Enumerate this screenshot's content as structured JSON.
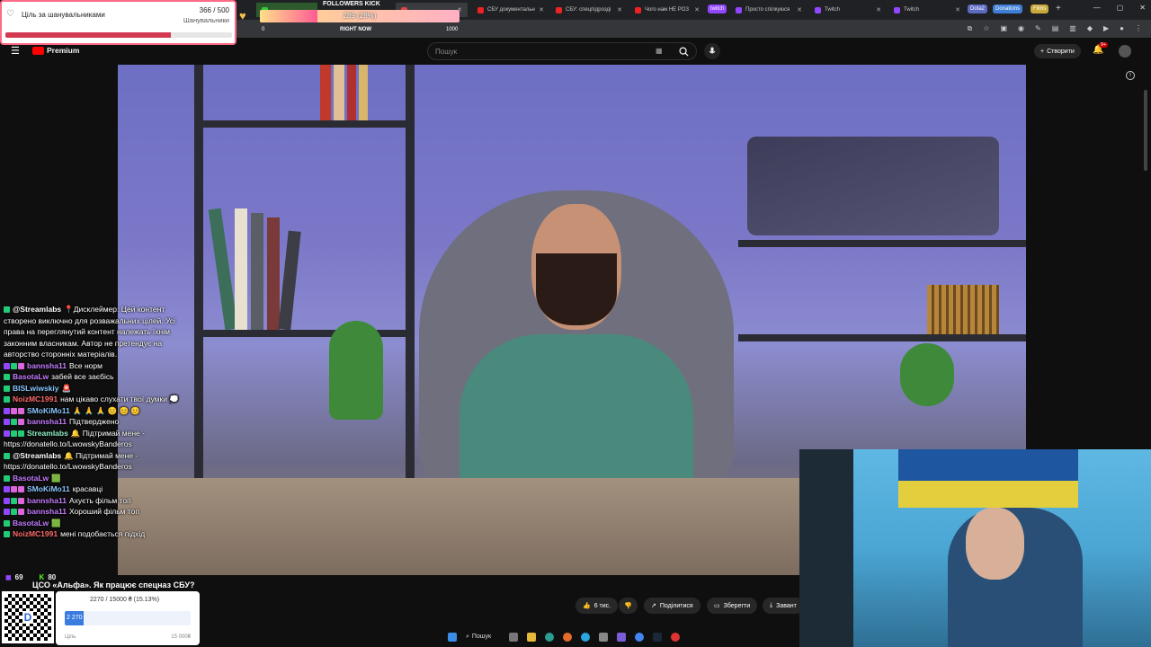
{
  "browser": {
    "tabs": [
      {
        "label": "",
        "color": "#2d8a2d"
      },
      {
        "label": "",
        "color": "#d44"
      },
      {
        "label": "СБУ документальн",
        "color": "#e22"
      },
      {
        "label": "СБУ: спецпідрозді",
        "color": "#e22"
      },
      {
        "label": "Чого нам НЕ РОЗ",
        "color": "#e22"
      },
      {
        "label": "",
        "color": "#9146ff"
      },
      {
        "label": "Просто спілкуюся",
        "color": "#9146ff"
      },
      {
        "label": "Twitch",
        "color": "#9146ff"
      },
      {
        "label": "Twitch",
        "color": "#9146ff"
      }
    ],
    "pills": {
      "twitch": "twitch",
      "dota": "Dota2",
      "donations": "Donations",
      "films": "Films"
    }
  },
  "youtube": {
    "logo": "Premium",
    "search_placeholder": "Пошук",
    "create_label": "Створити",
    "notif_count": "9+"
  },
  "goal": {
    "title": "Ціль за шанувальниками",
    "count": "366 / 500",
    "subtitle": "Шанувальники",
    "progress": 0.732
  },
  "kick": {
    "title": "FOLLOWERS KICK",
    "value_text": "289 (28%)",
    "progress": 0.289,
    "min": "0",
    "max": "1000",
    "caption": "RIGHT NOW"
  },
  "chat": [
    {
      "user": "@Streamlabs",
      "color": "#ffffff",
      "badges": [
        "#2c7"
      ],
      "text": "📍Дисклеймер: Цей контент створено виключно для розважальних цілей. Усі права на переглянутий контент належать їхнім законним власникам. Автор не претендує на авторство сторонніх матеріалів."
    },
    {
      "user": "bannsha11",
      "color": "#c57cff",
      "badges": [
        "#9146ff",
        "#2c7",
        "#d6d"
      ],
      "text": "Все норм"
    },
    {
      "user": "BasotaLw",
      "color": "#c57cff",
      "badges": [
        "#2c7"
      ],
      "text": "забей все заєбісь"
    },
    {
      "user": "BISLwiwskiy",
      "color": "#8ac6ff",
      "badges": [
        "#2c7"
      ],
      "text": "🚨"
    },
    {
      "user": "NoizMC1991",
      "color": "#ff6b6b",
      "badges": [
        "#2c7"
      ],
      "text": "нам цікаво слухати твої думки 💭"
    },
    {
      "user": "SMoKiMo11",
      "color": "#8ac6ff",
      "badges": [
        "#9146ff",
        "#d6d",
        "#d6d"
      ],
      "text": "🙏 🙏 🙏 😊 😊 😊"
    },
    {
      "user": "bannsha11",
      "color": "#c57cff",
      "badges": [
        "#9146ff",
        "#2c7",
        "#d6d"
      ],
      "text": "Підтверджено"
    },
    {
      "user": "Streamlabs",
      "color": "#8ef0c7",
      "badges": [
        "#9146ff",
        "#2c7",
        "#2c7"
      ],
      "text": "🔔 Підтримай мене - https://donatello.to/LwowskyBanderos"
    },
    {
      "user": "@Streamlabs",
      "color": "#ffffff",
      "badges": [
        "#2c7"
      ],
      "text": "🔔 Підтримай мене - https://donatello.to/LwowskyBanderos"
    },
    {
      "user": "BasotaLw",
      "color": "#c57cff",
      "badges": [
        "#2c7"
      ],
      "text": "🟩"
    },
    {
      "user": "SMoKiMo11",
      "color": "#8ac6ff",
      "badges": [
        "#9146ff",
        "#d6d",
        "#d6d"
      ],
      "text": "красавці"
    },
    {
      "user": "bannsha11",
      "color": "#c57cff",
      "badges": [
        "#9146ff",
        "#2c7",
        "#d6d"
      ],
      "text": "Ахуєть фільм топ"
    },
    {
      "user": "bannsha11",
      "color": "#c57cff",
      "badges": [
        "#9146ff",
        "#2c7",
        "#d6d"
      ],
      "text": "Хороший фільм топ"
    },
    {
      "user": "BasotaLw",
      "color": "#c57cff",
      "badges": [
        "#2c7"
      ],
      "text": "🟩"
    },
    {
      "user": "NoizMC1991",
      "color": "#ff6b6b",
      "badges": [
        "#2c7"
      ],
      "text": "мені подобається підхід"
    }
  ],
  "viewers": {
    "twitch": "69",
    "kick": "80"
  },
  "video_title": "ЦСО «Альфа». Як працює спецназ СБУ?",
  "actions": {
    "like": "6 тис.",
    "share": "Поділитися",
    "save": "Зберегти",
    "download": "Завант"
  },
  "donation": {
    "progress_text": "2270 / 15000 ₴ (15.13%)",
    "bar_label": "2 270",
    "progress": 0.1513,
    "goal_label": "Ціль",
    "goal_amount": "15 000₴"
  },
  "taskbar": {
    "search": "Пошук"
  }
}
